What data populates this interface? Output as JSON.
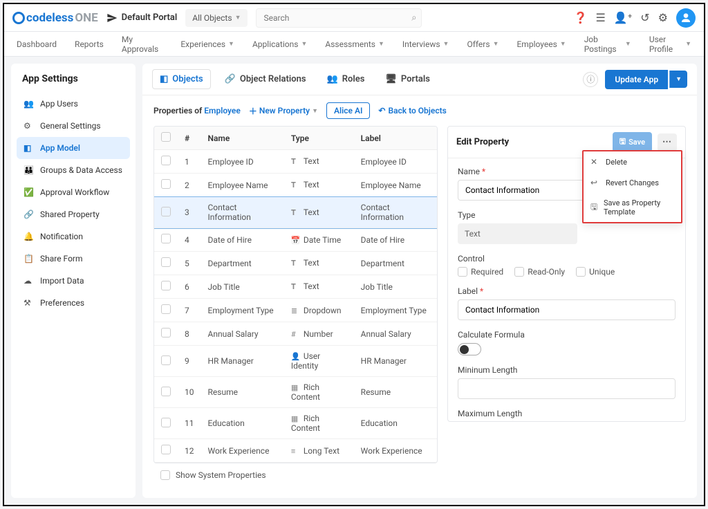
{
  "brand": {
    "name_a": "codeless",
    "name_b": "ONE"
  },
  "portal": "Default Portal",
  "objects_select": "All Objects",
  "search_placeholder": "Search",
  "nav": [
    "Dashboard",
    "Reports",
    "My Approvals",
    "Experiences",
    "Applications",
    "Assessments",
    "Interviews",
    "Offers",
    "Employees",
    "Job Postings",
    "User Profile"
  ],
  "nav_has_caret": [
    false,
    false,
    false,
    true,
    true,
    true,
    true,
    true,
    true,
    true,
    true
  ],
  "sidebar_title": "App Settings",
  "sidebar": [
    {
      "label": "App Users",
      "icon": "users"
    },
    {
      "label": "General Settings",
      "icon": "gear"
    },
    {
      "label": "App Model",
      "icon": "cube",
      "active": true
    },
    {
      "label": "Groups & Data Access",
      "icon": "group"
    },
    {
      "label": "Approval Workflow",
      "icon": "check"
    },
    {
      "label": "Shared Property",
      "icon": "share-alt"
    },
    {
      "label": "Notification",
      "icon": "bell"
    },
    {
      "label": "Share Form",
      "icon": "form"
    },
    {
      "label": "Import Data",
      "icon": "cloud-up"
    },
    {
      "label": "Preferences",
      "icon": "pref"
    }
  ],
  "tabs": [
    {
      "label": "Objects",
      "icon": "cube",
      "active": true
    },
    {
      "label": "Object Relations",
      "icon": "link"
    },
    {
      "label": "Roles",
      "icon": "users"
    },
    {
      "label": "Portals",
      "icon": "desktop"
    }
  ],
  "update_btn": "Update App",
  "subhead": {
    "prefix": "Properties of",
    "entity": "Employee",
    "new": "New Property",
    "alice": "Alice AI",
    "back": "Back to Objects"
  },
  "columns": [
    "#",
    "Name",
    "Type",
    "Label"
  ],
  "rows": [
    {
      "n": "1",
      "name": "Employee ID",
      "type": "Text",
      "icon": "T",
      "label": "Employee ID"
    },
    {
      "n": "2",
      "name": "Employee Name",
      "type": "Text",
      "icon": "T",
      "label": "Employee Name"
    },
    {
      "n": "3",
      "name": "Contact Information",
      "type": "Text",
      "icon": "T",
      "label": "Contact Information",
      "selected": true
    },
    {
      "n": "4",
      "name": "Date of Hire",
      "type": "Date Time",
      "icon": "cal",
      "label": "Date of Hire"
    },
    {
      "n": "5",
      "name": "Department",
      "type": "Text",
      "icon": "T",
      "label": "Department"
    },
    {
      "n": "6",
      "name": "Job Title",
      "type": "Text",
      "icon": "T",
      "label": "Job Title"
    },
    {
      "n": "7",
      "name": "Employment Type",
      "type": "Dropdown",
      "icon": "dd",
      "label": "Employment Type"
    },
    {
      "n": "8",
      "name": "Annual Salary",
      "type": "Number",
      "icon": "num",
      "label": "Annual Salary"
    },
    {
      "n": "9",
      "name": "HR Manager",
      "type": "User Identity",
      "icon": "user",
      "label": "HR Manager"
    },
    {
      "n": "10",
      "name": "Resume",
      "type": "Rich Content",
      "icon": "rich",
      "label": "Resume"
    },
    {
      "n": "11",
      "name": "Education",
      "type": "Rich Content",
      "icon": "rich",
      "label": "Education"
    },
    {
      "n": "12",
      "name": "Work Experience",
      "type": "Long Text",
      "icon": "long",
      "label": "Work Experience"
    }
  ],
  "show_sys": "Show System Properties",
  "edit": {
    "title": "Edit Property",
    "save": "Save",
    "name_lbl": "Name",
    "name_val": "Contact Information",
    "type_lbl": "Type",
    "type_val": "Text",
    "control_lbl": "Control",
    "controls": [
      "Required",
      "Read-Only",
      "Unique"
    ],
    "label_lbl": "Label",
    "label_val": "Contact Information",
    "formula_lbl": "Calculate Formula",
    "min_lbl": "Mininum Length",
    "max_lbl": "Maximum Length"
  },
  "menu": [
    {
      "label": "Delete",
      "icon": "x"
    },
    {
      "label": "Revert Changes",
      "icon": "undo"
    },
    {
      "label": "Save as Property Template",
      "icon": "save"
    }
  ],
  "type_icons": {
    "T": "𝐓",
    "cal": "📅",
    "dd": "≣",
    "num": "#",
    "user": "👤",
    "rich": "▦",
    "long": "≡"
  }
}
